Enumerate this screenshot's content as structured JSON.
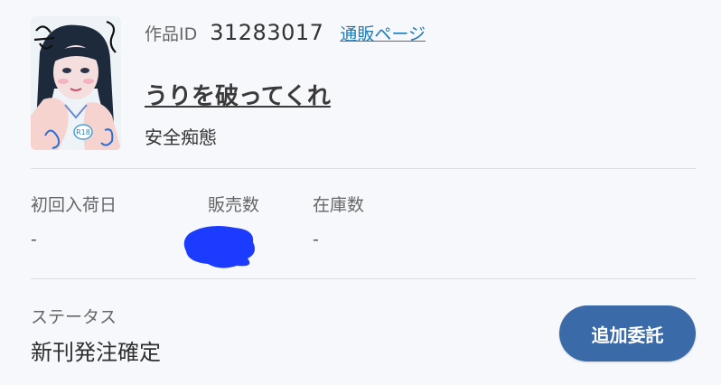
{
  "item": {
    "id_label": "作品ID",
    "id_value": "31283017",
    "shop_link_label": "通販ページ",
    "title": "うりを破ってくれ",
    "circle": "安全痴態",
    "cover_badge": "R18"
  },
  "stats": {
    "first_arrival_label": "初回入荷日",
    "first_arrival_value": "-",
    "sales_label": "販売数",
    "stock_label": "在庫数",
    "stock_value": "-"
  },
  "status": {
    "label": "ステータス",
    "value": "新刊発注確定"
  },
  "actions": {
    "consign_label": "追加委託"
  },
  "colors": {
    "button": "#3a6aa8",
    "link": "#1f7ab8",
    "redaction": "#1b3cff"
  }
}
